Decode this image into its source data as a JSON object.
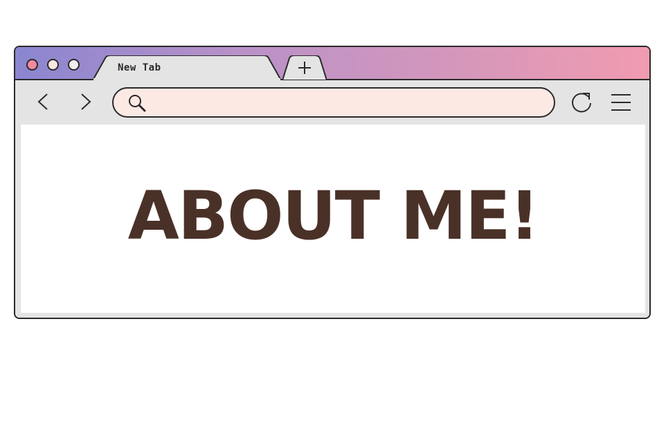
{
  "window": {
    "controls": {
      "close_color": "#f28aa0",
      "minimize_color": "#fbe6e2",
      "maximize_color": "#f5eeee"
    },
    "titlebar_gradient": [
      "#8a86d0",
      "#b891c8",
      "#d597bb",
      "#f19bb0"
    ]
  },
  "tabs": [
    {
      "label": "New Tab",
      "active": true
    }
  ],
  "new_tab": {
    "icon": "plus-icon"
  },
  "toolbar": {
    "back_icon": "chevron-left-icon",
    "forward_icon": "chevron-right-icon",
    "reload_icon": "reload-icon",
    "menu_icon": "hamburger-menu-icon"
  },
  "address_bar": {
    "icon": "search-icon",
    "value": "",
    "background": "#fde9e4"
  },
  "page": {
    "heading": "ABOUT ME!",
    "heading_color": "#4a3128"
  }
}
